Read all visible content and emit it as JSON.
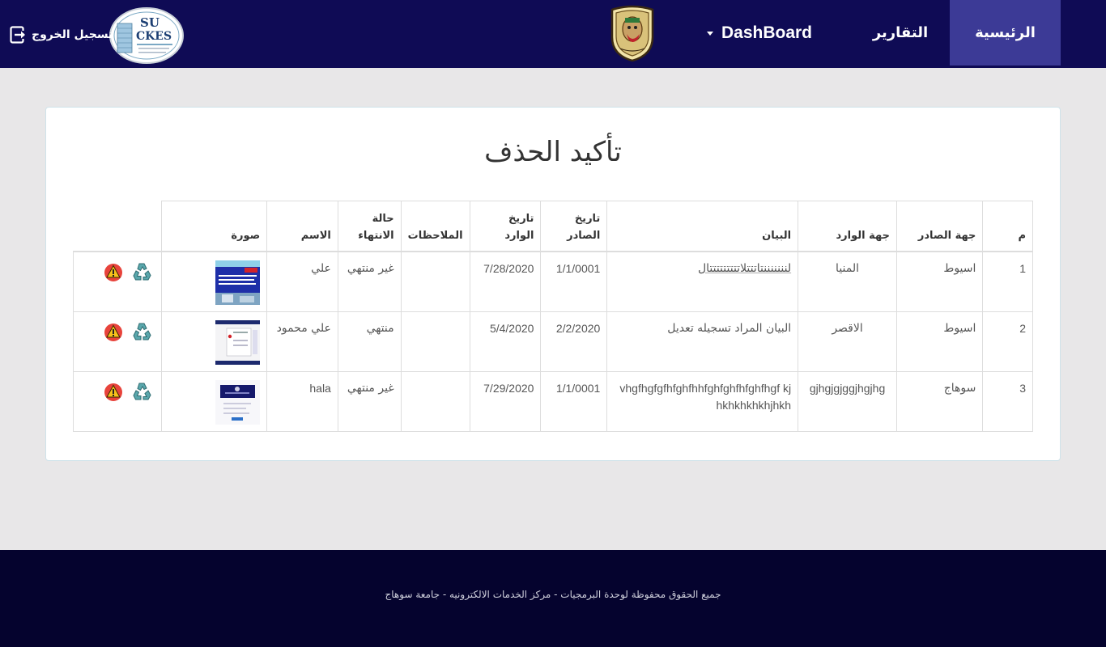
{
  "nav": {
    "home": "الرئيسية",
    "reports": "التقارير",
    "dashboard": "DashBoard",
    "logout": "تسجيل الخروج"
  },
  "logos": {
    "sckes_top": "SU",
    "sckes_bottom": "CKES"
  },
  "page": {
    "title": "تأكيد الحذف"
  },
  "table": {
    "headers": {
      "index": "م",
      "issuer": "جهة الصادر",
      "receiver": "جهة الوارد",
      "statement": "البيان",
      "issue_date_1": "تاريخ",
      "issue_date_2": "الصادر",
      "incoming_date": "تاريخ الوارد",
      "notes": "الملاحظات",
      "status_1": "حالة",
      "status_2": "الانتهاء",
      "name": "الاسم",
      "image": "صورة"
    },
    "rows": [
      {
        "index": "1",
        "issuer": "اسيوط",
        "receiver": "المنيا",
        "statement": "لنننننننتاتتتلاتتتتتتتتتال",
        "issue_date": "1/1/0001",
        "incoming_date": "7/28/2020",
        "notes": "",
        "status": "غير منتهي",
        "name": "علي"
      },
      {
        "index": "2",
        "issuer": "اسيوط",
        "receiver": "الاقصر",
        "statement": "البيان المراد تسجيله تعديل",
        "issue_date": "2/2/2020",
        "incoming_date": "5/4/2020",
        "notes": "",
        "status": "منتهي",
        "name": "علي محمود"
      },
      {
        "index": "3",
        "issuer": "سوهاج",
        "receiver": "gjhgjgjggjhgjhg",
        "statement": "vhgfhgfgfhfghfhhfghfghfhfghfhgf kjhkhkhkhkhjhkh",
        "issue_date": "1/1/0001",
        "incoming_date": "7/29/2020",
        "notes": "",
        "status": "غير منتهي",
        "name": "hala"
      }
    ]
  },
  "footer": {
    "text": "جميع الحقوق محفوظة لوحدة البرمجيات - مركز الخدمات الالكترونيه - جامعة سوهاج"
  },
  "colors": {
    "navbar": "#0f0b55",
    "nav_active": "#3c3a96",
    "footer": "#05032e",
    "background": "#e8e7e8",
    "warning_icon": "#e8433b",
    "recycle_icon": "#3f8f96"
  }
}
